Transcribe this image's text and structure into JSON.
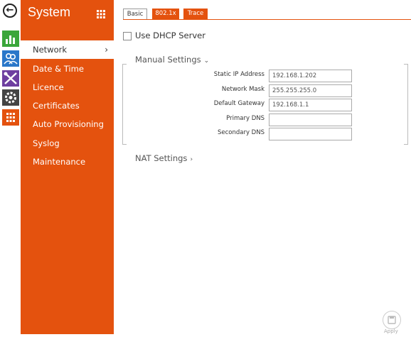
{
  "sidebar": {
    "title": "System",
    "items": [
      {
        "label": "Network",
        "active": true
      },
      {
        "label": "Date & Time"
      },
      {
        "label": "Licence"
      },
      {
        "label": "Certificates"
      },
      {
        "label": "Auto Provisioning"
      },
      {
        "label": "Syslog"
      },
      {
        "label": "Maintenance"
      }
    ],
    "active_chevron": "›"
  },
  "rail": {
    "back_glyph": "←",
    "tile_colors": [
      "#3aa63a",
      "#2a77c9",
      "#6e3fa0",
      "#444444",
      "#e4520e"
    ],
    "icons": [
      "back-icon",
      "chart-icon",
      "users-icon",
      "tools-icon",
      "gear-icon",
      "grid-icon"
    ]
  },
  "tabs": [
    {
      "label": "Basic",
      "selected": true
    },
    {
      "label": "802.1x",
      "selected": false
    },
    {
      "label": "Trace",
      "selected": false
    }
  ],
  "dhcp": {
    "label": "Use DHCP Server",
    "checked": false
  },
  "manual": {
    "title": "Manual Settings",
    "arrow": "⌄",
    "fields": [
      {
        "label": "Static IP Address",
        "value": "192.168.1.202"
      },
      {
        "label": "Network Mask",
        "value": "255.255.255.0"
      },
      {
        "label": "Default Gateway",
        "value": "192.168.1.1"
      },
      {
        "label": "Primary DNS",
        "value": ""
      },
      {
        "label": "Secondary DNS",
        "value": ""
      }
    ]
  },
  "nat": {
    "title": "NAT Settings",
    "arrow": "›"
  },
  "apply": {
    "label": "Apply"
  },
  "colors": {
    "accent": "#e4520e"
  }
}
